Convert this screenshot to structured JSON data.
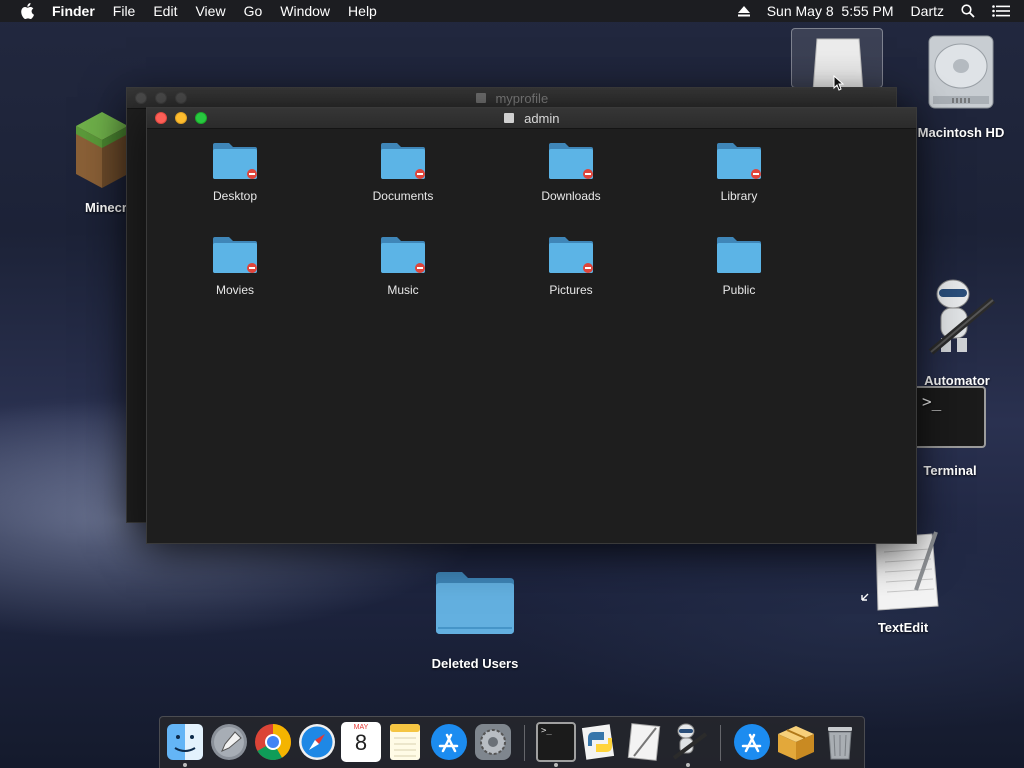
{
  "menubar": {
    "app_name": "Finder",
    "items": [
      "File",
      "Edit",
      "View",
      "Go",
      "Window",
      "Help"
    ],
    "clock": "Sun May 8  5:55 PM",
    "user": "Dartz"
  },
  "desktop_icons": {
    "macintosh_hd": "Macintosh HD",
    "minecraft": "Minecr",
    "automator": "Automator",
    "terminal": "Terminal",
    "textedit": "TextEdit",
    "deleted_users": "Deleted Users"
  },
  "windows": {
    "back": {
      "title": "myprofile"
    },
    "front": {
      "title": "admin",
      "folders": [
        {
          "name": "Desktop",
          "restricted": true
        },
        {
          "name": "Documents",
          "restricted": true
        },
        {
          "name": "Downloads",
          "restricted": true
        },
        {
          "name": "Library",
          "restricted": true
        },
        {
          "name": "Movies",
          "restricted": true
        },
        {
          "name": "Music",
          "restricted": true
        },
        {
          "name": "Pictures",
          "restricted": true
        },
        {
          "name": "Public",
          "restricted": false
        }
      ]
    }
  },
  "dock": {
    "calendar_month": "MAY",
    "calendar_day": "8",
    "terminal_prompt": ">_",
    "items": [
      "finder-icon",
      "launchpad-icon",
      "chrome-icon",
      "safari-icon",
      "calendar-icon",
      "notes-icon",
      "app-store-icon",
      "system-preferences-icon",
      "terminal-icon",
      "python-launcher-icon",
      "script-editor-icon",
      "automator-icon",
      "app-store-downloads-icon",
      "installer-icon",
      "trash-icon"
    ]
  },
  "colors": {
    "folder_blue": "#5cb4e6",
    "restricted_badge": "#e0443a",
    "menubar_bg": "#1c1c1e"
  }
}
